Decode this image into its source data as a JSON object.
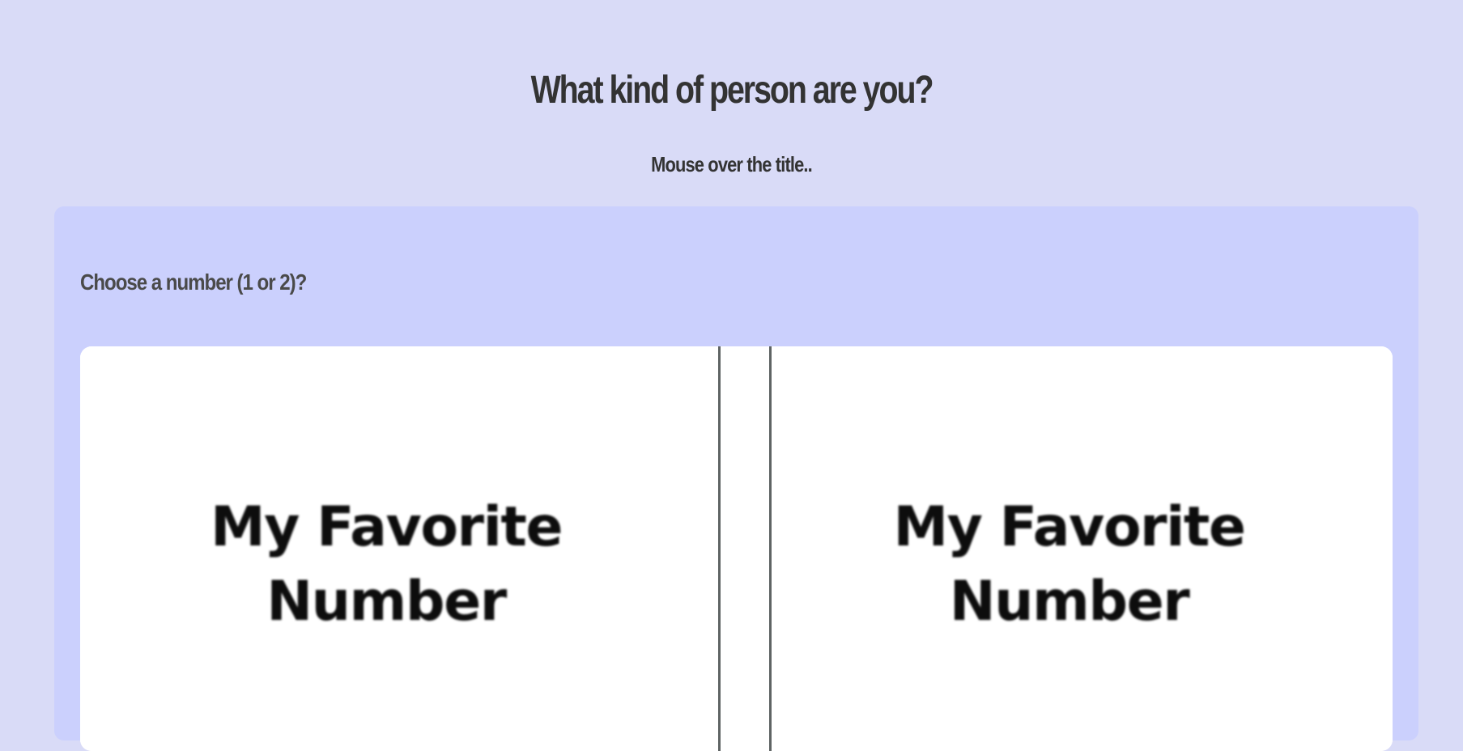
{
  "header": {
    "title": "What kind of person are you?",
    "subtitle": "Mouse over the title.."
  },
  "quiz": {
    "question": "Choose a number (1 or 2)?",
    "options": [
      {
        "title_line1": "My Favorite",
        "title_line2": "Number"
      },
      {
        "title_line1": "My Favorite",
        "title_line2": "Number"
      }
    ]
  },
  "colors": {
    "background": "#d9dbf7",
    "card": "#cbd0fd",
    "text": "#333333"
  }
}
